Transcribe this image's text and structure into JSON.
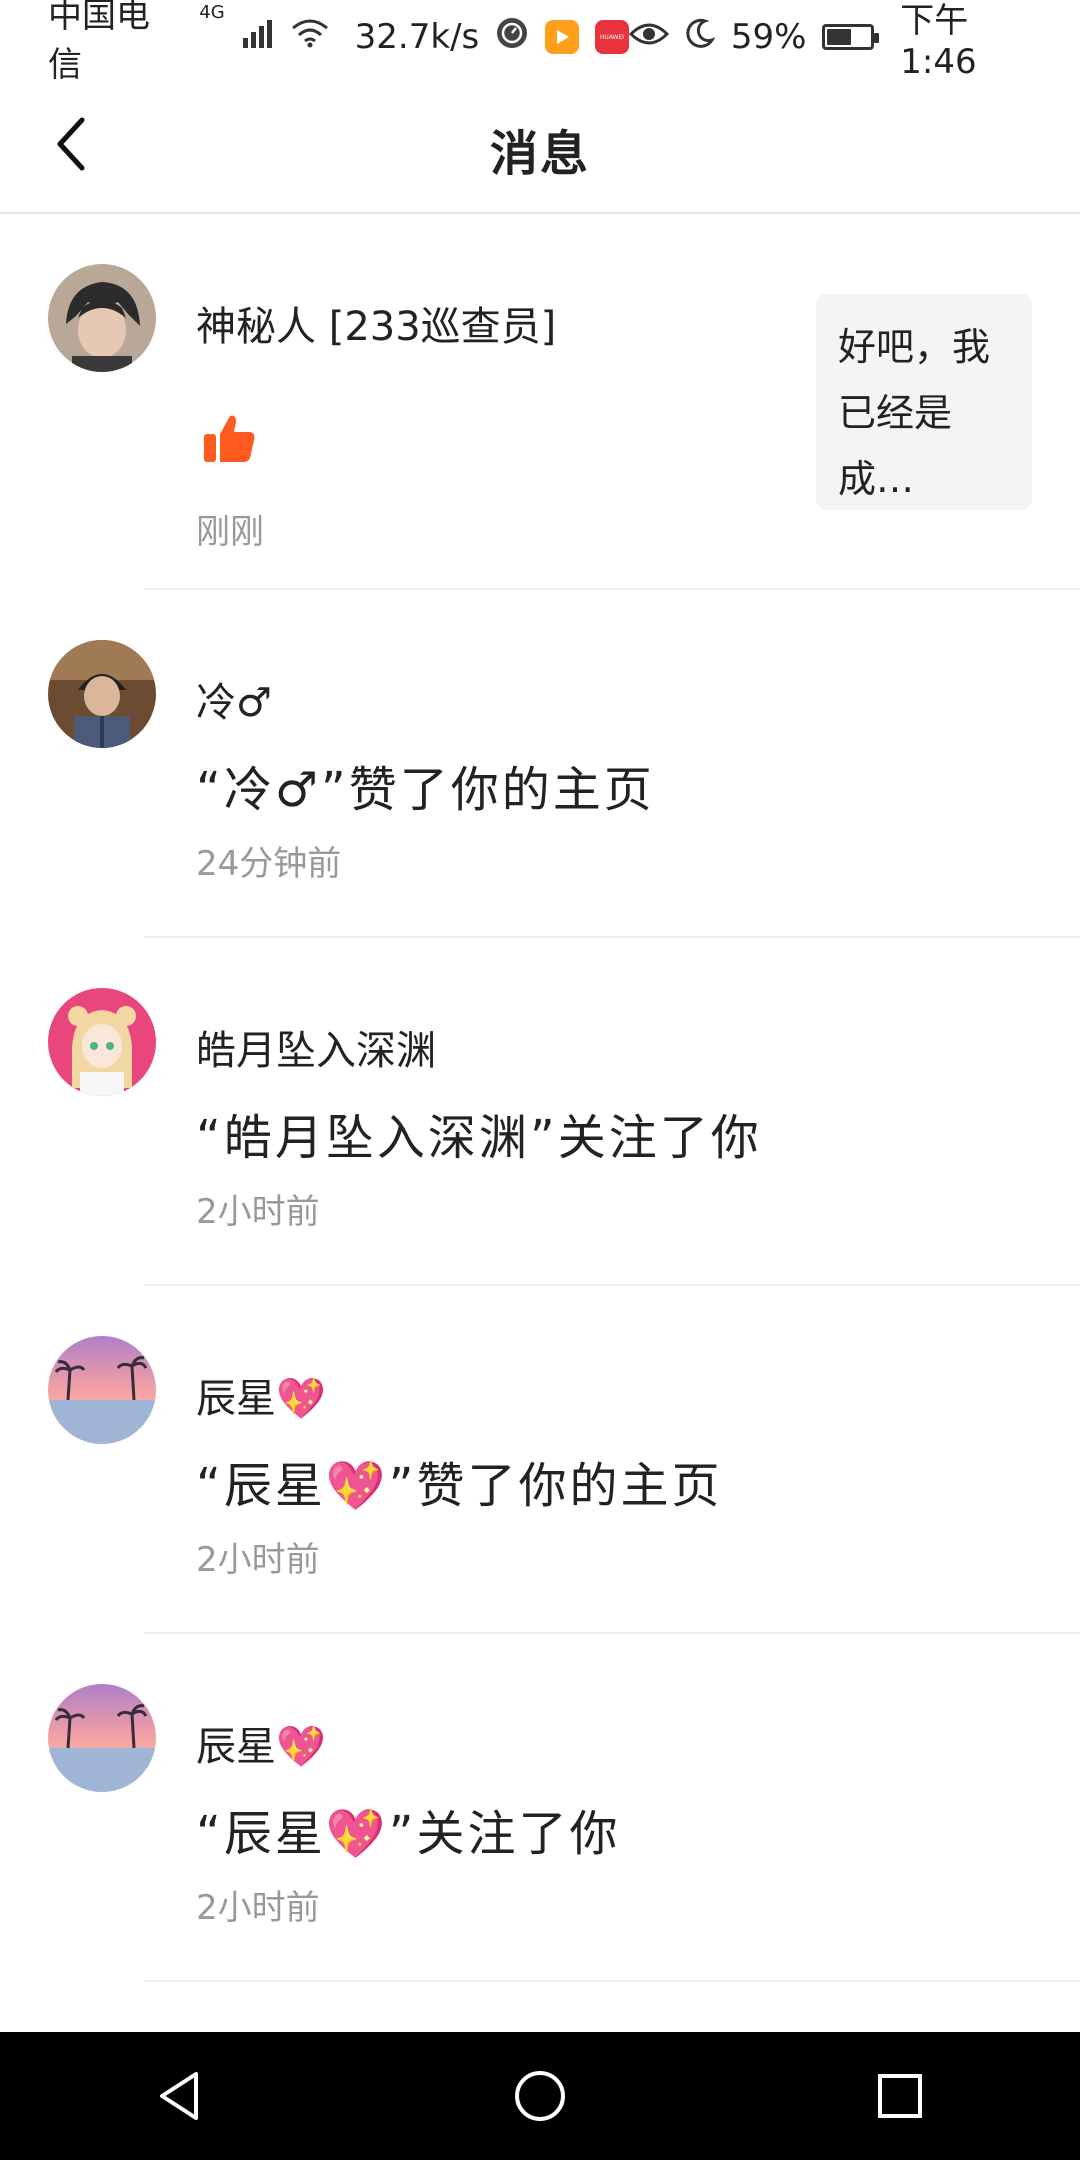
{
  "status_bar": {
    "carrier": "中国电信",
    "network": "4G",
    "speed": "32.7k/s",
    "battery": "59%",
    "battery_level": 0.59,
    "time": "下午1:46",
    "huawei_label": "HUAWEI"
  },
  "header": {
    "title": "消息"
  },
  "messages": [
    {
      "name": "神秘人 [233巡查员]",
      "type": "like-comment",
      "icon": "thumbs-up-icon",
      "preview": "好吧，我已经是成…",
      "time": "刚刚"
    },
    {
      "name": "冷♂",
      "content": "“冷♂”赞了你的主页",
      "time": "24分钟前"
    },
    {
      "name": "皓月坠入深渊",
      "content": "“皓月坠入深渊”关注了你",
      "time": "2小时前"
    },
    {
      "name": "辰星💖",
      "content": "“辰星💖”赞了你的主页",
      "time": "2小时前"
    },
    {
      "name": "辰星💖",
      "content": "“辰星💖”关注了你",
      "time": "2小时前"
    }
  ],
  "nav_bar": {
    "back": "back-triangle-icon",
    "home": "home-circle-icon",
    "recents": "recents-square-icon"
  },
  "colors": {
    "accent": "#ff5a1f",
    "time_gray": "#999999",
    "divider": "#ececec"
  }
}
